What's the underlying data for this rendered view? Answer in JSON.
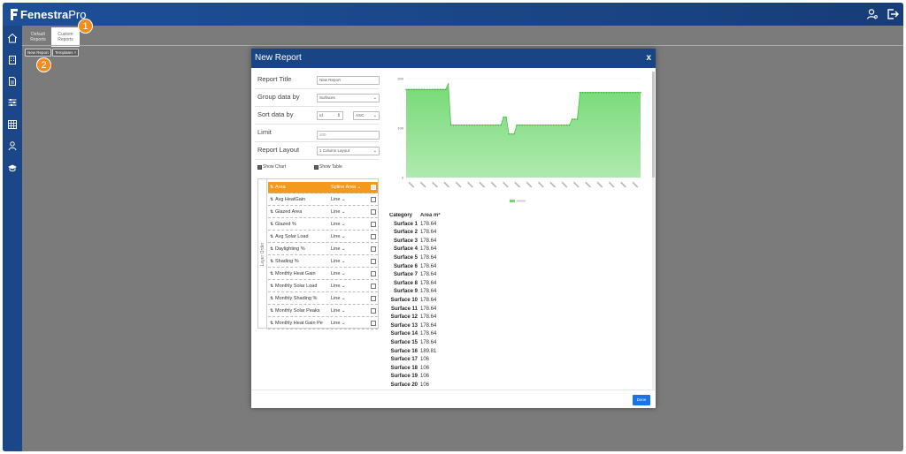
{
  "app": {
    "brand_bold": "Fenestra",
    "brand_light": "Pro"
  },
  "icons": {
    "topbar": [
      "user-settings-icon",
      "logout-icon"
    ],
    "sidebar": [
      "home-icon",
      "building-icon",
      "report-icon",
      "sliders-icon",
      "table-icon",
      "user-icon",
      "education-icon"
    ]
  },
  "tabs": [
    {
      "line1": "Default",
      "line2": "Reports"
    },
    {
      "line1": "Custom",
      "line2": "Reports"
    }
  ],
  "badges": [
    "1",
    "2"
  ],
  "toolbar": {
    "new_report": "New Report",
    "templates": "Templates ˅"
  },
  "modal": {
    "title": "New Report",
    "close": "x",
    "done": "Done",
    "form": {
      "report_title_label": "Report Title",
      "report_title_value": "New Report",
      "group_label": "Group data by",
      "group_value": "Surfaces",
      "sort_label": "Sort data by",
      "sort_field": "Id",
      "sort_dir": "ASC",
      "limit_label": "Limit",
      "limit_placeholder": "100",
      "layout_label": "Report Layout",
      "layout_value": "1 Column Layout",
      "show_chart": "Show Chart",
      "show_table": "Show Table",
      "layer_order": "Layer Order"
    },
    "layers": [
      {
        "name": "Area",
        "type": "Spline Area"
      },
      {
        "name": "Avg HeatGain",
        "type": "Line"
      },
      {
        "name": "Glazed Area",
        "type": "Line"
      },
      {
        "name": "Glazed %",
        "type": "Line"
      },
      {
        "name": "Avg Solar Load",
        "type": "Line"
      },
      {
        "name": "Daylighting %",
        "type": "Line"
      },
      {
        "name": "Shading %",
        "type": "Line"
      },
      {
        "name": "Monthly Heat Gain",
        "type": "Line"
      },
      {
        "name": "Monthly Solar Load",
        "type": "Line"
      },
      {
        "name": "Monthly Shading %",
        "type": "Line"
      },
      {
        "name": "Monthly Solar Peaks",
        "type": "Line"
      },
      {
        "name": "Monthly Heat Gain Pe",
        "type": "Line"
      }
    ],
    "table": {
      "headers": [
        "Category",
        "Area m²"
      ],
      "rows": [
        [
          "Surface 1",
          "178.64"
        ],
        [
          "Surface 2",
          "178.64"
        ],
        [
          "Surface 3",
          "178.64"
        ],
        [
          "Surface 4",
          "178.64"
        ],
        [
          "Surface 5",
          "178.64"
        ],
        [
          "Surface 6",
          "178.64"
        ],
        [
          "Surface 7",
          "178.64"
        ],
        [
          "Surface 8",
          "178.64"
        ],
        [
          "Surface 9",
          "178.64"
        ],
        [
          "Surface 10",
          "178.64"
        ],
        [
          "Surface 11",
          "178.64"
        ],
        [
          "Surface 12",
          "178.64"
        ],
        [
          "Surface 13",
          "178.64"
        ],
        [
          "Surface 14",
          "178.64"
        ],
        [
          "Surface 15",
          "178.64"
        ],
        [
          "Surface 16",
          "189.81"
        ],
        [
          "Surface 17",
          "106"
        ],
        [
          "Surface 18",
          "106"
        ],
        [
          "Surface 19",
          "106"
        ],
        [
          "Surface 20",
          "106"
        ]
      ]
    }
  },
  "chart_data": {
    "type": "area",
    "ylim": [
      0,
      200
    ],
    "yticks": [
      "0",
      "100",
      "200"
    ],
    "series_color": "#6fd86f",
    "values": [
      178,
      178,
      178,
      178,
      178,
      178,
      178,
      178,
      178,
      178,
      178,
      178,
      178,
      178,
      178,
      178,
      189,
      106,
      106,
      106,
      106,
      106,
      106,
      106,
      106,
      106,
      106,
      106,
      106,
      106,
      106,
      106,
      106,
      106,
      106,
      106,
      106,
      122,
      122,
      88,
      88,
      88,
      106,
      106,
      106,
      106,
      106,
      106,
      106,
      106,
      106,
      106,
      106,
      106,
      106,
      106,
      106,
      106,
      106,
      106,
      106,
      106,
      106,
      118,
      118,
      118,
      172,
      172,
      172,
      172,
      172,
      172,
      172,
      172,
      172,
      172,
      172,
      172,
      172,
      172,
      172,
      172,
      172,
      172,
      172,
      172,
      172,
      172,
      172,
      172
    ]
  }
}
